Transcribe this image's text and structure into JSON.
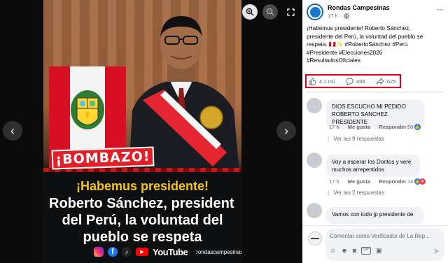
{
  "viewer": {
    "prev_icon": "chevron-left-icon",
    "next_icon": "chevron-right-icon",
    "zoom_in_icon": "zoom-in-icon",
    "zoom_out_icon": "zoom-out-icon",
    "fullscreen_icon": "fullscreen-icon"
  },
  "image": {
    "stamp": "¡BOMBAZO!",
    "headline_line1": "¡Habemus presidente!",
    "headline_line2": "Roberto Sánchez, president",
    "headline_line3": "del Perú, la voluntad del",
    "headline_line4": "pueblo se respeta",
    "brand_word": "YouTube",
    "handle": "rondascampesinas@"
  },
  "post": {
    "page_name": "Rondas Campesinas",
    "time": "17 h",
    "privacy_sep": "·",
    "more_label": "···",
    "text_lines": [
      "¡Habemus presidente! Roberto Sánchez,",
      "presidente del Perú, la voluntad del pueblo se",
      "respeta. 🇵🇪✨ #RobertoSánchez #Perú",
      "#Presidente #Elecciones2026",
      "#ResultadosOficiales"
    ],
    "likes": "4,1 mil",
    "comments": "488",
    "shares": "625"
  },
  "comments": [
    {
      "text_lines": [
        "DIOS ESCUCHO MI PEDIDO",
        "ROBERTO SANCHEZ PRESIDENTE"
      ],
      "time": "17 h",
      "like": "Me gusta",
      "reply": "Responder",
      "reactions": "58",
      "replies": "Ver las 9 respuestas"
    },
    {
      "text_lines": [
        "Voy a esperar los Doritos y veré",
        "muchos arrepentidos"
      ],
      "time": "17 h",
      "like": "Me gusta",
      "reply": "Responder",
      "reactions": "14",
      "replies": "Ver las 2 respuestas"
    },
    {
      "text_lines": [
        "Vamos con todo jp presidente de"
      ]
    }
  ],
  "composer": {
    "placeholder": "Comentar como Verificador de La Rep..."
  },
  "colors": {
    "accent": "#1877f2",
    "highlight_border": "#e0001b",
    "headline_yellow": "#f5c518",
    "stamp_red": "#e41e26"
  }
}
